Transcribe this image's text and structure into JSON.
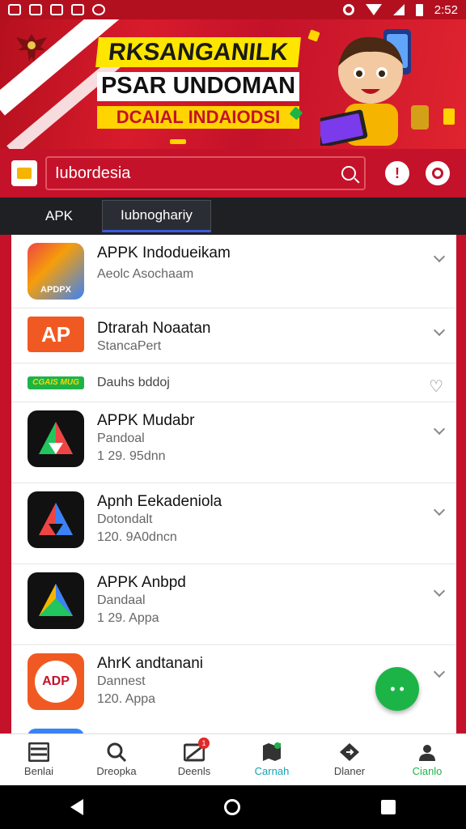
{
  "status_bar": {
    "time": "2:52"
  },
  "banner": {
    "line1": "RKSANGANILK",
    "line2": "PSAR UNDOMAN",
    "line3": "DCAIAL INDAIODSI"
  },
  "search": {
    "value": "Iubordesia"
  },
  "tabs": [
    {
      "label": "APK"
    },
    {
      "label": "Iubnoghariy"
    }
  ],
  "apps": [
    {
      "title": "APPK Indodueikam",
      "subtitle": "Aeolc Asochaam",
      "meta": ""
    },
    {
      "title": "Dtrarah Noaatan",
      "subtitle": "StancaPert",
      "meta": ""
    },
    {
      "title": "Dauhs bddoj",
      "subtitle": "",
      "meta": "",
      "badge_text": "CGAIS MUG"
    },
    {
      "title": "APPK Mudabr",
      "subtitle": "Pandoal",
      "meta": "1 29. 95dnn"
    },
    {
      "title": "Apnh Eekadeniola",
      "subtitle": "Dotondalt",
      "meta": "120. 9A0dncn"
    },
    {
      "title": "APPK Anbpd",
      "subtitle": "Dandaal",
      "meta": "1 29. Appa"
    },
    {
      "title": "AhrK andtanani",
      "subtitle": "Dannest",
      "meta": "120. Appa"
    }
  ],
  "app_icon_texts": {
    "first": "APDPX",
    "second": "AP",
    "seventh": "ADP"
  },
  "bottom_nav": [
    {
      "label": "Benlai",
      "icon": "list-icon"
    },
    {
      "label": "Dreopka",
      "icon": "search-icon"
    },
    {
      "label": "Deenls",
      "icon": "downloads-icon",
      "badge": "1"
    },
    {
      "label": "Carnah",
      "icon": "map-icon"
    },
    {
      "label": "Dlaner",
      "icon": "diamond-icon"
    },
    {
      "label": "Cianlo",
      "icon": "user-icon"
    }
  ],
  "colors": {
    "brand_red": "#c4122a",
    "fab_green": "#1db447",
    "active_teal": "#12a3b5"
  }
}
